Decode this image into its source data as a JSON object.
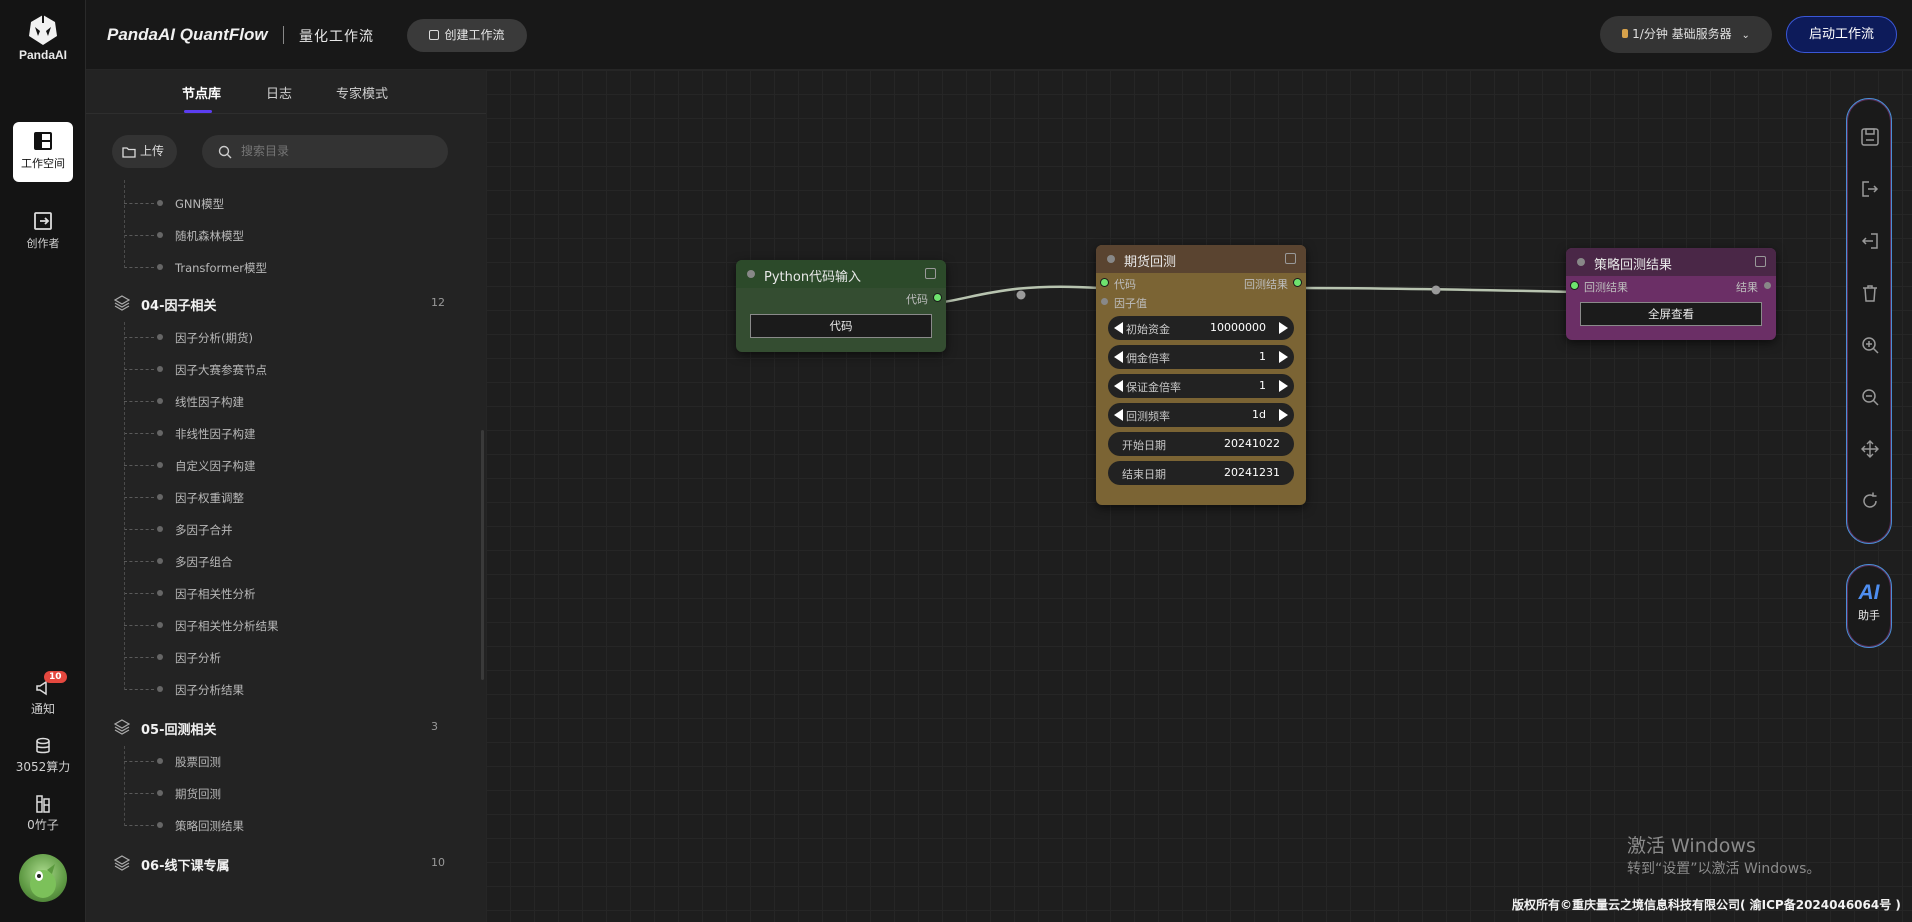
{
  "app": {
    "logo_text": "PandaAI",
    "brand": "PandaAI QuantFlow",
    "subtitle": "量化工作流",
    "create_workflow": "创建工作流",
    "server_label": "1/分钟  基础服务器",
    "start_workflow": "启动工作流"
  },
  "rail": {
    "workspace": "工作空间",
    "creator": "创作者",
    "notify": "通知",
    "notify_badge": "10",
    "compute": "3052算力",
    "bamboo": "0竹子"
  },
  "panel": {
    "tabs": [
      "节点库",
      "日志",
      "专家模式"
    ],
    "upload": "上传",
    "search_placeholder": "搜索目录",
    "top_items": [
      "GNN模型",
      "随机森林模型",
      "Transformer模型"
    ],
    "groups": [
      {
        "title": "04-因子相关",
        "count": "12",
        "items": [
          "因子分析(期货)",
          "因子大赛参赛节点",
          "线性因子构建",
          "非线性因子构建",
          "自定义因子构建",
          "因子权重调整",
          "多因子合并",
          "多因子组合",
          "因子相关性分析",
          "因子相关性分析结果",
          "因子分析",
          "因子分析结果"
        ]
      },
      {
        "title": "05-回测相关",
        "count": "3",
        "items": [
          "股票回测",
          "期货回测",
          "策略回测结果"
        ]
      },
      {
        "title": "06-线下课专属",
        "count": "10",
        "items": []
      }
    ]
  },
  "nodes": {
    "python": {
      "title": "Python代码输入",
      "out_port": "代码",
      "button": "代码",
      "color": "#3b6b35"
    },
    "futures": {
      "title": "期货回测",
      "in_ports": [
        "代码",
        "因子值"
      ],
      "out_port": "回测结果",
      "fields": [
        {
          "label": "初始资金",
          "value": "10000000",
          "arrows": true
        },
        {
          "label": "佣金倍率",
          "value": "1",
          "arrows": true
        },
        {
          "label": "保证金倍率",
          "value": "1",
          "arrows": true
        },
        {
          "label": "回测频率",
          "value": "1d",
          "arrows": true
        },
        {
          "label": "开始日期",
          "value": "20241022",
          "arrows": false
        },
        {
          "label": "结束日期",
          "value": "20241231",
          "arrows": false
        }
      ],
      "color": "#7b6434"
    },
    "result": {
      "title": "策略回测结果",
      "in_port": "回测结果",
      "out_port": "结果",
      "button": "全屏查看",
      "color": "#6b2f66"
    }
  },
  "toolbar": {
    "icons": [
      "save-icon",
      "export-icon",
      "import-icon",
      "trash-icon",
      "zoom-in-icon",
      "zoom-out-icon",
      "move-icon",
      "refresh-icon"
    ],
    "ai_label": "AI",
    "ai_caption": "助手"
  },
  "watermark": {
    "line1": "激活 Windows",
    "line2": "转到“设置”以激活 Windows。"
  },
  "footer": "版权所有©重庆量云之境信息科技有限公司( 渝ICP备2024046064号 )",
  "colors": {
    "accent": "#5b3df0",
    "start_button_bg": "#0d1b5a",
    "pin_active": "#6ee36e",
    "badge": "#e5483f",
    "ai_blue": "#4e8ef0"
  }
}
